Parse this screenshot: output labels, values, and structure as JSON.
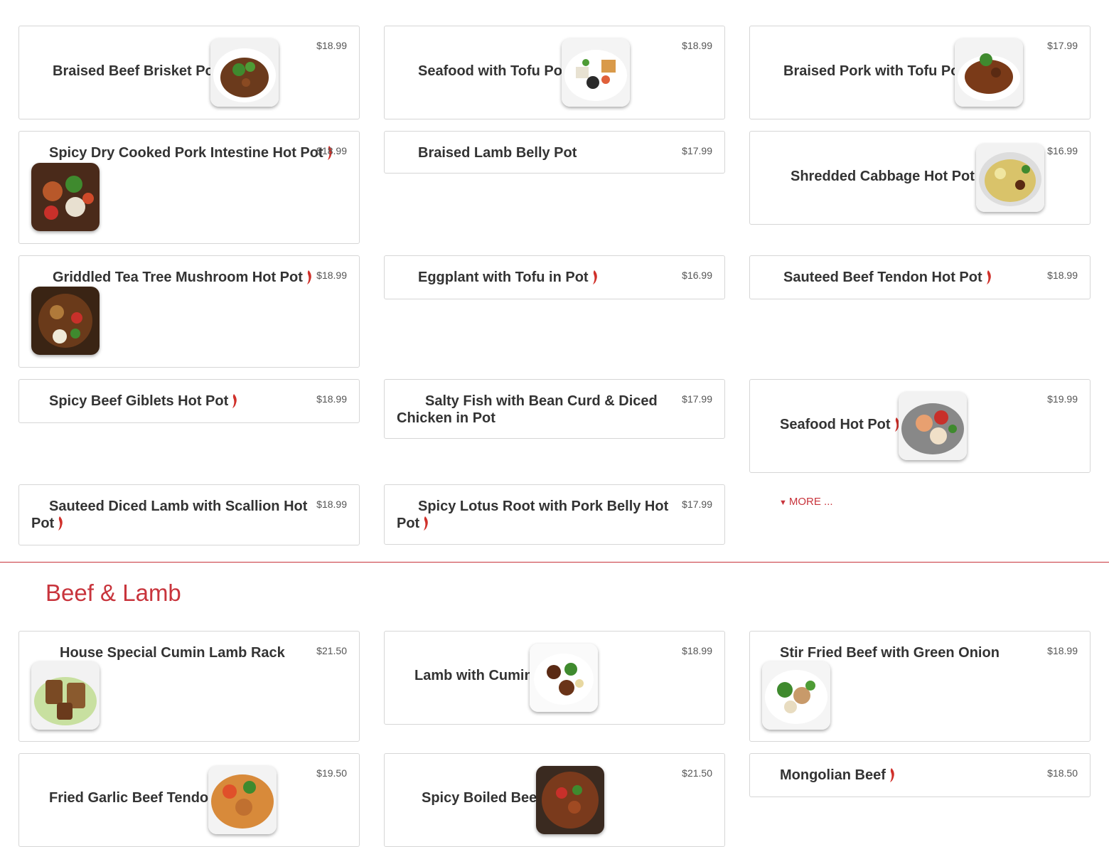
{
  "colors": {
    "accent": "#c8343c",
    "border": "#d6d6d6",
    "pepper": "#d0302a"
  },
  "more_link": "MORE ...",
  "sections": {
    "beef_lamb": {
      "title": "Beef & Lamb"
    }
  },
  "items": {
    "braised_beef_brisket_pot": {
      "name": "Braised Beef Brisket Pot",
      "price": "$18.99"
    },
    "seafood_tofu_pot": {
      "name": "Seafood with Tofu Pot",
      "price": "$18.99"
    },
    "braised_pork_tofu_pot": {
      "name": "Braised Pork with Tofu Pot",
      "price": "$17.99"
    },
    "pork_intestine_hot_pot": {
      "name": "Spicy Dry Cooked Pork Intestine Hot Pot",
      "price": "$18.99"
    },
    "braised_lamb_belly_pot": {
      "name": "Braised Lamb Belly Pot",
      "price": "$17.99"
    },
    "shredded_cabbage_hot_pot": {
      "name": "Shredded Cabbage Hot Pot",
      "price": "$16.99"
    },
    "tea_tree_mushroom_hot_pot": {
      "name": "Griddled Tea Tree Mushroom Hot Pot",
      "price": "$18.99"
    },
    "eggplant_tofu_pot": {
      "name": "Eggplant with Tofu in Pot",
      "price": "$16.99"
    },
    "beef_tendon_hot_pot": {
      "name": "Sauteed Beef Tendon Hot Pot",
      "price": "$18.99"
    },
    "beef_giblets_hot_pot": {
      "name": "Spicy Beef Giblets Hot Pot",
      "price": "$18.99"
    },
    "salty_fish_bean_curd": {
      "name": "Salty Fish with Bean Curd & Diced Chicken in Pot",
      "price": "$17.99"
    },
    "seafood_hot_pot": {
      "name": "Seafood Hot Pot",
      "price": "$19.99"
    },
    "diced_lamb_scallion": {
      "name": "Sauteed Diced Lamb with Scallion Hot Pot",
      "price": "$18.99"
    },
    "lotus_root_pork_belly": {
      "name": "Spicy Lotus Root with Pork Belly Hot Pot",
      "price": "$17.99"
    },
    "cumin_lamb_rack": {
      "name": "House Special Cumin Lamb Rack",
      "price": "$21.50"
    },
    "lamb_cumin": {
      "name": "Lamb with Cumin",
      "price": "$18.99"
    },
    "beef_green_onion": {
      "name": "Stir Fried Beef with Green Onion",
      "price": "$18.99"
    },
    "garlic_beef_tendon": {
      "name": "Fried Garlic Beef Tendon",
      "price": "$19.50"
    },
    "spicy_boiled_beef": {
      "name": "Spicy Boiled Beef",
      "price": "$21.50"
    },
    "mongolian_beef": {
      "name": "Mongolian Beef",
      "price": "$18.50"
    }
  }
}
